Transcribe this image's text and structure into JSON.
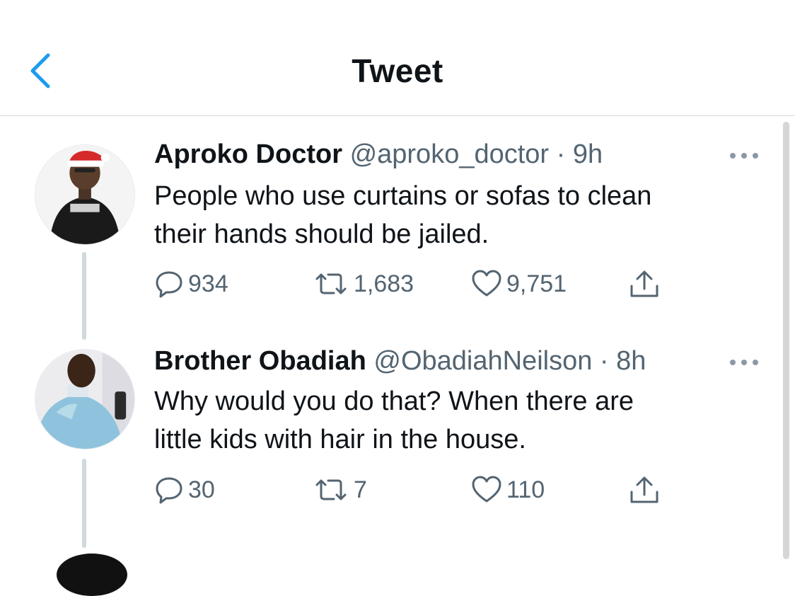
{
  "header": {
    "title": "Tweet"
  },
  "tweets": [
    {
      "name": "Aproko Doctor",
      "handle": "@aproko_doctor",
      "separator": "·",
      "time": "9h",
      "text_lines": [
        "People who use curtains or sofas to clean",
        "their hands should be jailed."
      ],
      "replies": "934",
      "retweets": "1,683",
      "likes": "9,751"
    },
    {
      "name": "Brother Obadiah",
      "handle": "@ObadiahNeilson",
      "separator": "·",
      "time": "8h",
      "text_lines": [
        "Why would you do that? When there are",
        "little kids with hair in the house."
      ],
      "replies": "30",
      "retweets": "7",
      "likes": "110"
    }
  ],
  "icons": {
    "back": "chevron-left-icon",
    "more": "more-horizontal-icon",
    "reply": "speech-bubble-icon",
    "retweet": "retweet-arrows-icon",
    "like": "heart-icon",
    "share": "share-upload-icon"
  },
  "colors": {
    "accent": "#1d9bf0",
    "text": "#0f1419",
    "secondary": "#536471",
    "divider": "#cfd9de"
  }
}
